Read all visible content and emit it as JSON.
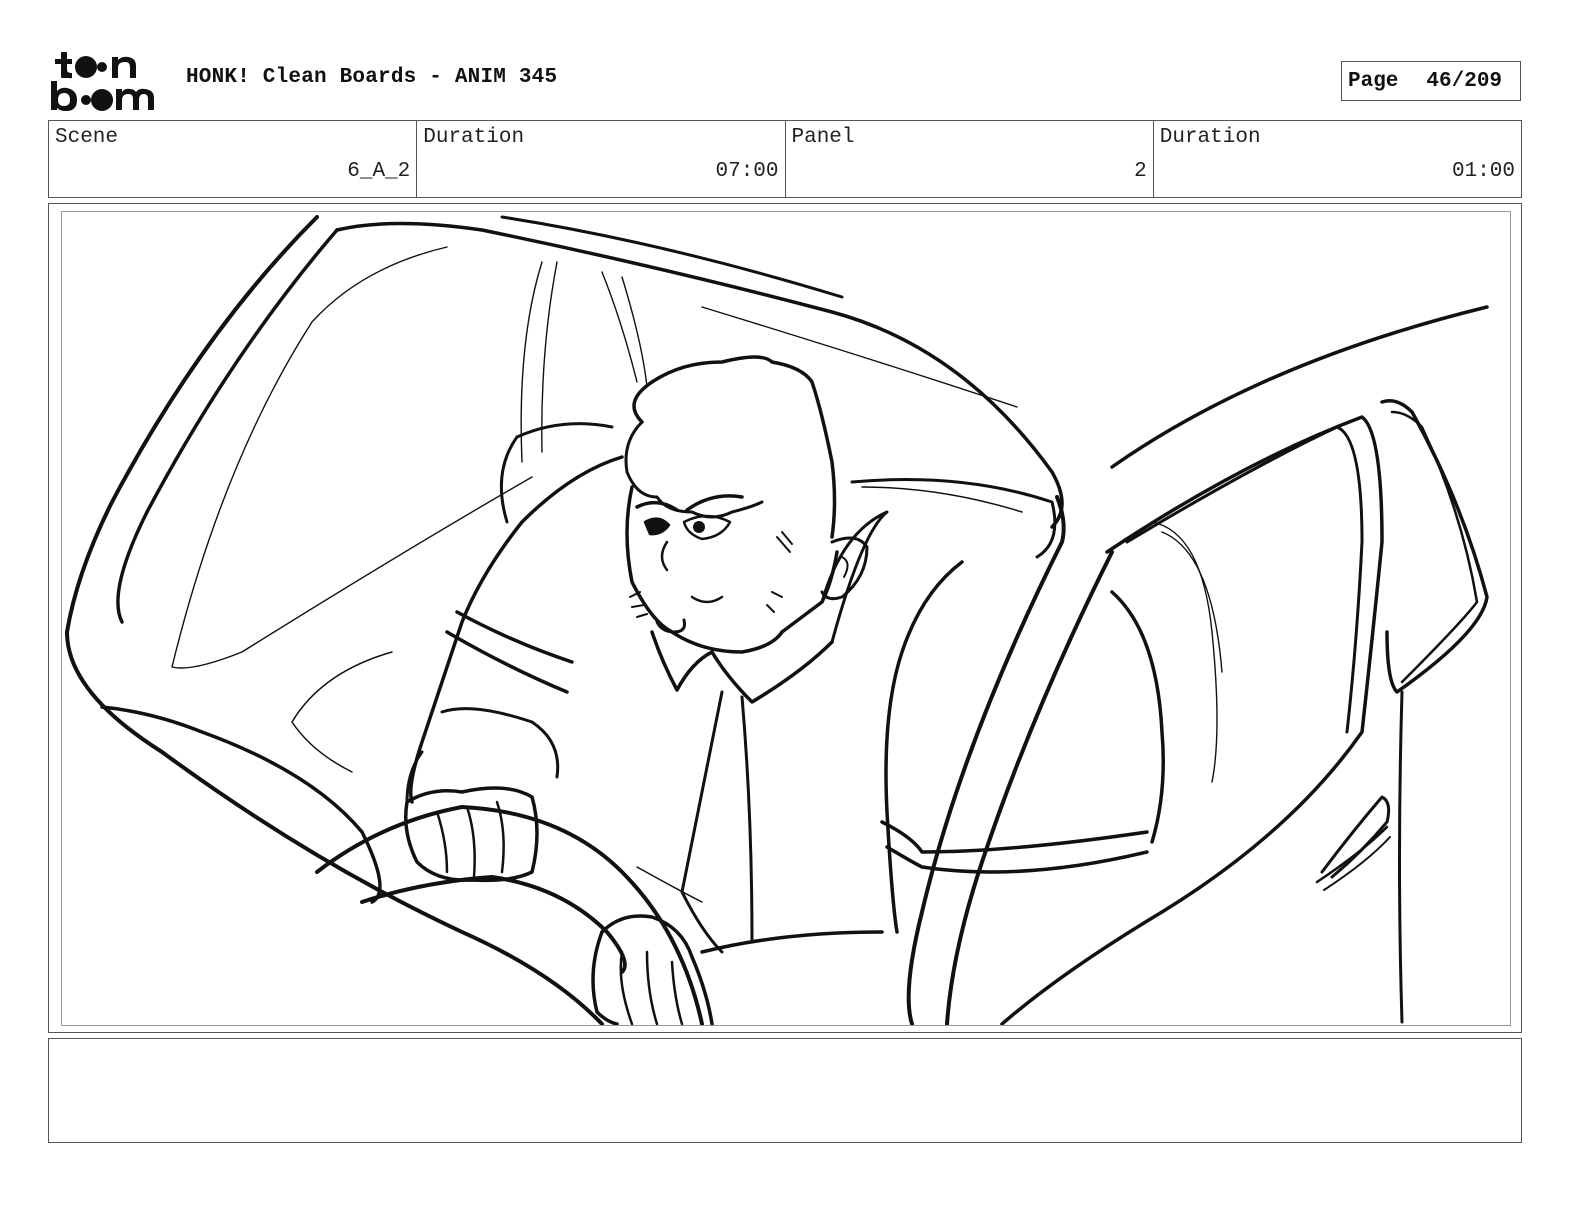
{
  "header": {
    "logo_text": "toon boom",
    "title": "HONK! Clean Boards - ANIM 345",
    "page_label": "Page",
    "page_value": "46/209"
  },
  "info": {
    "scene_label": "Scene",
    "scene_value": "6_A_2",
    "scene_duration_label": "Duration",
    "scene_duration_value": "07:00",
    "panel_label": "Panel",
    "panel_value": "2",
    "panel_duration_label": "Duration",
    "panel_duration_value": "01:00"
  },
  "notes": {
    "text": ""
  }
}
